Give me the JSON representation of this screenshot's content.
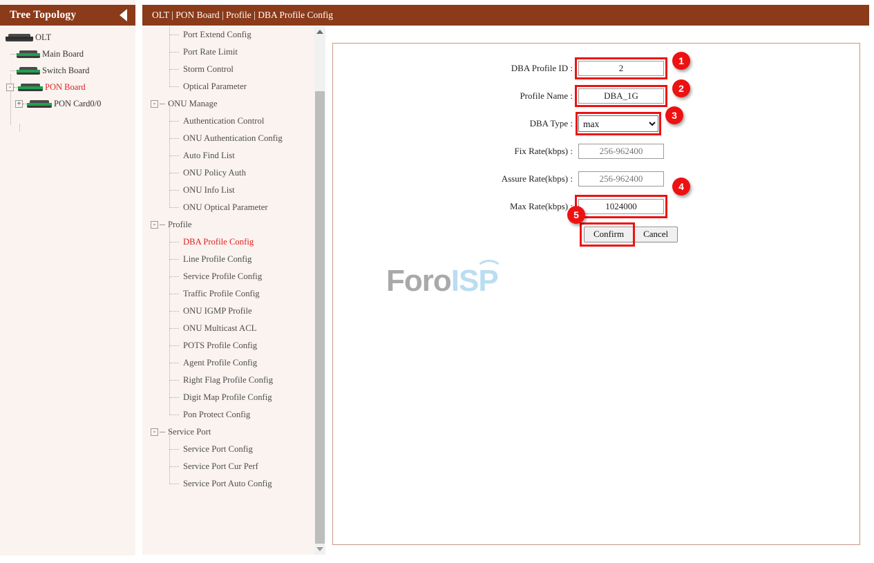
{
  "tree_panel": {
    "title": "Tree Topology",
    "collapse_icon": "triangle-left-icon",
    "nodes": [
      {
        "label": "OLT",
        "depth": 0,
        "icon": "device-icon",
        "expander": "",
        "active": false
      },
      {
        "label": "Main Board",
        "depth": 1,
        "icon": "device-icon",
        "expander": "",
        "active": false
      },
      {
        "label": "Switch Board",
        "depth": 1,
        "icon": "device-icon",
        "expander": "",
        "active": false
      },
      {
        "label": "PON Board",
        "depth": 1,
        "icon": "device-icon",
        "expander": "-",
        "active": true
      },
      {
        "label": "PON Card0/0",
        "depth": 2,
        "icon": "device-icon",
        "expander": "+",
        "active": false
      }
    ]
  },
  "breadcrumb": {
    "text": "OLT | PON Board | Profile | DBA Profile Config"
  },
  "menu": {
    "items": [
      {
        "label": "Port Extend Config",
        "type": "leaf",
        "selected": false
      },
      {
        "label": "Port Rate Limit",
        "type": "leaf",
        "selected": false
      },
      {
        "label": "Storm Control",
        "type": "leaf",
        "selected": false
      },
      {
        "label": "Optical Parameter",
        "type": "leaf",
        "selected": false
      },
      {
        "label": "ONU Manage",
        "type": "group",
        "expander": "-",
        "selected": false
      },
      {
        "label": "Authentication Control",
        "type": "leaf",
        "selected": false
      },
      {
        "label": "ONU Authentication Config",
        "type": "leaf",
        "selected": false
      },
      {
        "label": "Auto Find List",
        "type": "leaf",
        "selected": false
      },
      {
        "label": "ONU Policy Auth",
        "type": "leaf",
        "selected": false
      },
      {
        "label": "ONU Info List",
        "type": "leaf",
        "selected": false
      },
      {
        "label": "ONU Optical Parameter",
        "type": "leaf",
        "selected": false
      },
      {
        "label": "Profile",
        "type": "group",
        "expander": "-",
        "selected": false
      },
      {
        "label": "DBA Profile Config",
        "type": "leaf",
        "selected": true
      },
      {
        "label": "Line Profile Config",
        "type": "leaf",
        "selected": false
      },
      {
        "label": "Service Profile Config",
        "type": "leaf",
        "selected": false
      },
      {
        "label": "Traffic Profile Config",
        "type": "leaf",
        "selected": false
      },
      {
        "label": "ONU IGMP Profile",
        "type": "leaf",
        "selected": false
      },
      {
        "label": "ONU Multicast ACL",
        "type": "leaf",
        "selected": false
      },
      {
        "label": "POTS Profile Config",
        "type": "leaf",
        "selected": false
      },
      {
        "label": "Agent Profile Config",
        "type": "leaf",
        "selected": false
      },
      {
        "label": "Right Flag Profile Config",
        "type": "leaf",
        "selected": false
      },
      {
        "label": "Digit Map Profile Config",
        "type": "leaf",
        "selected": false
      },
      {
        "label": "Pon Protect Config",
        "type": "leaf",
        "selected": false
      },
      {
        "label": "Service Port",
        "type": "group",
        "expander": "-",
        "selected": false
      },
      {
        "label": "Service Port Config",
        "type": "leaf",
        "selected": false
      },
      {
        "label": "Service Port Cur Perf",
        "type": "leaf",
        "selected": false
      },
      {
        "label": "Service Port Auto Config",
        "type": "leaf",
        "selected": false
      }
    ],
    "scrollbar": {
      "up_icon": "scroll-up-arrow-icon",
      "down_icon": "scroll-down-arrow-icon"
    }
  },
  "form": {
    "fields": [
      {
        "label": "DBA Profile ID :",
        "value": "2",
        "placeholder": "",
        "kind": "text",
        "disabled": false,
        "highlighted": true
      },
      {
        "label": "Profile Name :",
        "value": "DBA_1G",
        "placeholder": "",
        "kind": "text",
        "disabled": false,
        "highlighted": true
      },
      {
        "label": "DBA Type :",
        "value": "max",
        "kind": "select",
        "options": [
          "max"
        ],
        "disabled": false,
        "highlighted": true
      },
      {
        "label": "Fix Rate(kbps) :",
        "value": "",
        "placeholder": "256-962400",
        "kind": "text",
        "disabled": true,
        "highlighted": false
      },
      {
        "label": "Assure Rate(kbps) :",
        "value": "",
        "placeholder": "256-962400",
        "kind": "text",
        "disabled": true,
        "highlighted": false
      },
      {
        "label": "Max Rate(kbps) :",
        "value": "1024000",
        "placeholder": "",
        "kind": "text",
        "disabled": false,
        "highlighted": true
      }
    ],
    "confirm_label": "Confirm",
    "cancel_label": "Cancel"
  },
  "annotations": {
    "badges": [
      {
        "number": "1",
        "target": "dba-profile-id-input"
      },
      {
        "number": "2",
        "target": "profile-name-input"
      },
      {
        "number": "3",
        "target": "dba-type-select"
      },
      {
        "number": "4",
        "target": "max-rate-input"
      },
      {
        "number": "5",
        "target": "confirm-button"
      }
    ],
    "accent_color": "#EE1111"
  },
  "watermark": {
    "part1": "Foro",
    "part2": "ISP",
    "color1": "#A9A9A9",
    "color2": "#BBDDF2"
  },
  "theme": {
    "header_bg": "#8B3A1A",
    "panel_bg": "#FAF3EF",
    "content_border": "#C89585",
    "selected_text": "#E02020"
  }
}
